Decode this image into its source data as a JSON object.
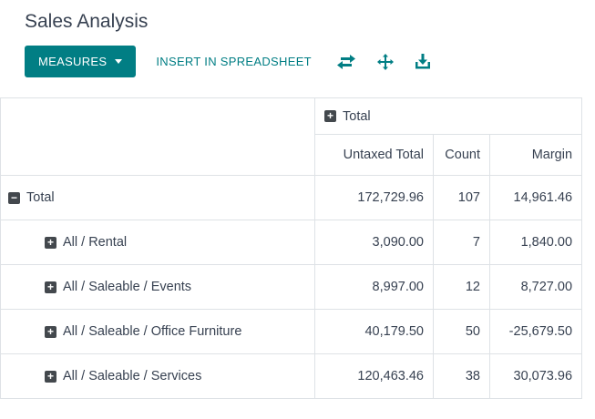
{
  "page": {
    "title": "Sales Analysis"
  },
  "toolbar": {
    "measures_label": "MEASURES",
    "insert_label": "INSERT IN SPREADSHEET"
  },
  "icons": {
    "flip_axis": "flip-axis-icon",
    "expand_all": "expand-all-icon",
    "download": "download-icon"
  },
  "colors": {
    "accent": "#017e84",
    "text": "#374151",
    "border": "#dee2e6",
    "icon_square": "#43484d"
  },
  "pivot": {
    "col_group": {
      "label": "Total",
      "expandable": true
    },
    "measures": [
      "Untaxed Total",
      "Count",
      "Margin"
    ],
    "rows": [
      {
        "label": "Total",
        "state": "expanded",
        "level": 0,
        "values": [
          "172,729.96",
          "107",
          "14,961.46"
        ]
      },
      {
        "label": "All / Rental",
        "state": "collapsed",
        "level": 1,
        "values": [
          "3,090.00",
          "7",
          "1,840.00"
        ]
      },
      {
        "label": "All / Saleable / Events",
        "state": "collapsed",
        "level": 1,
        "values": [
          "8,997.00",
          "12",
          "8,727.00"
        ]
      },
      {
        "label": "All / Saleable / Office Furniture",
        "state": "collapsed",
        "level": 1,
        "values": [
          "40,179.50",
          "50",
          "-25,679.50"
        ]
      },
      {
        "label": "All / Saleable / Services",
        "state": "collapsed",
        "level": 1,
        "values": [
          "120,463.46",
          "38",
          "30,073.96"
        ]
      }
    ]
  }
}
